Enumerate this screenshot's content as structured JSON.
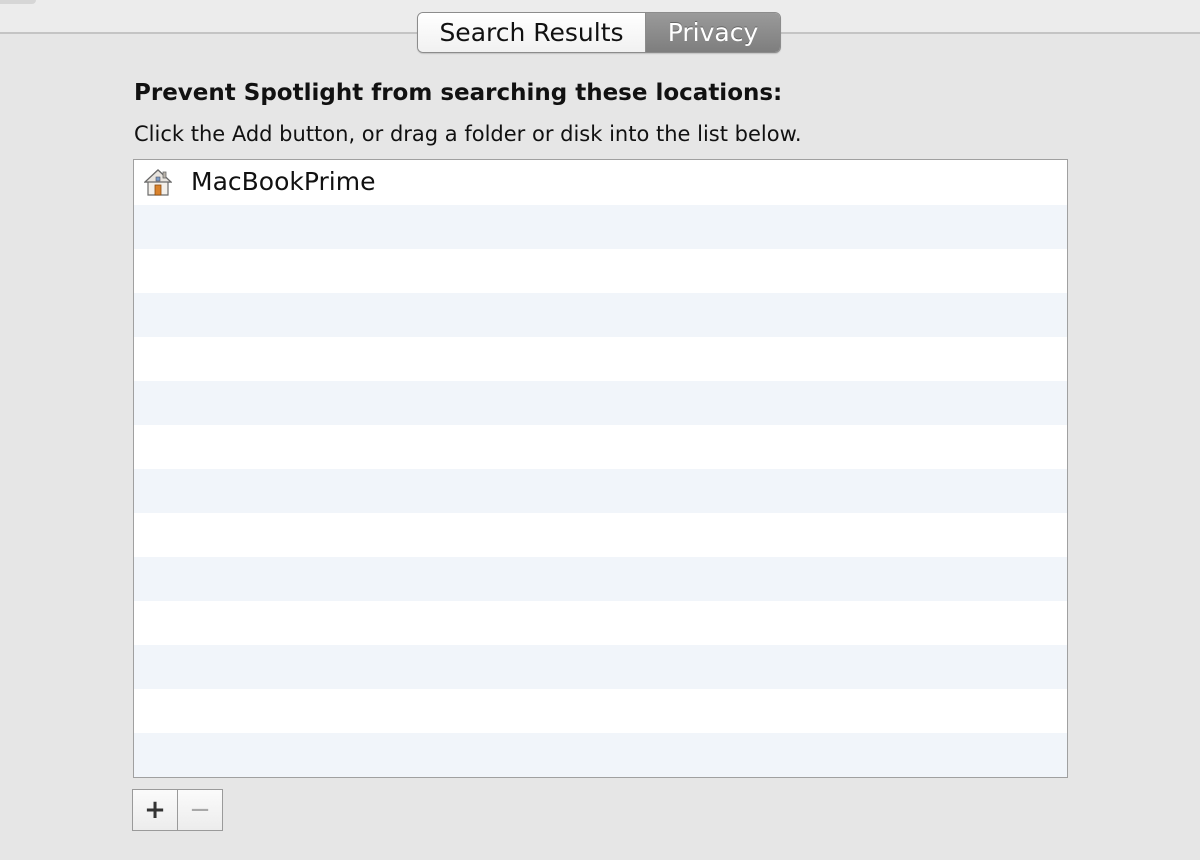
{
  "tabs": {
    "search_results_label": "Search Results",
    "privacy_label": "Privacy",
    "active": "Privacy"
  },
  "privacy": {
    "heading": "Prevent Spotlight from searching these locations:",
    "instructions": "Click the Add button, or drag a folder or disk into the list below.",
    "locations": [
      {
        "name": "MacBookPrime",
        "icon": "home-folder-icon"
      }
    ]
  },
  "buttons": {
    "add_label": "+",
    "remove_label": "−"
  },
  "colors": {
    "active_tab": "#8a8a8a",
    "row_alternate": "#f1f5fa",
    "background": "#e6e6e6"
  }
}
